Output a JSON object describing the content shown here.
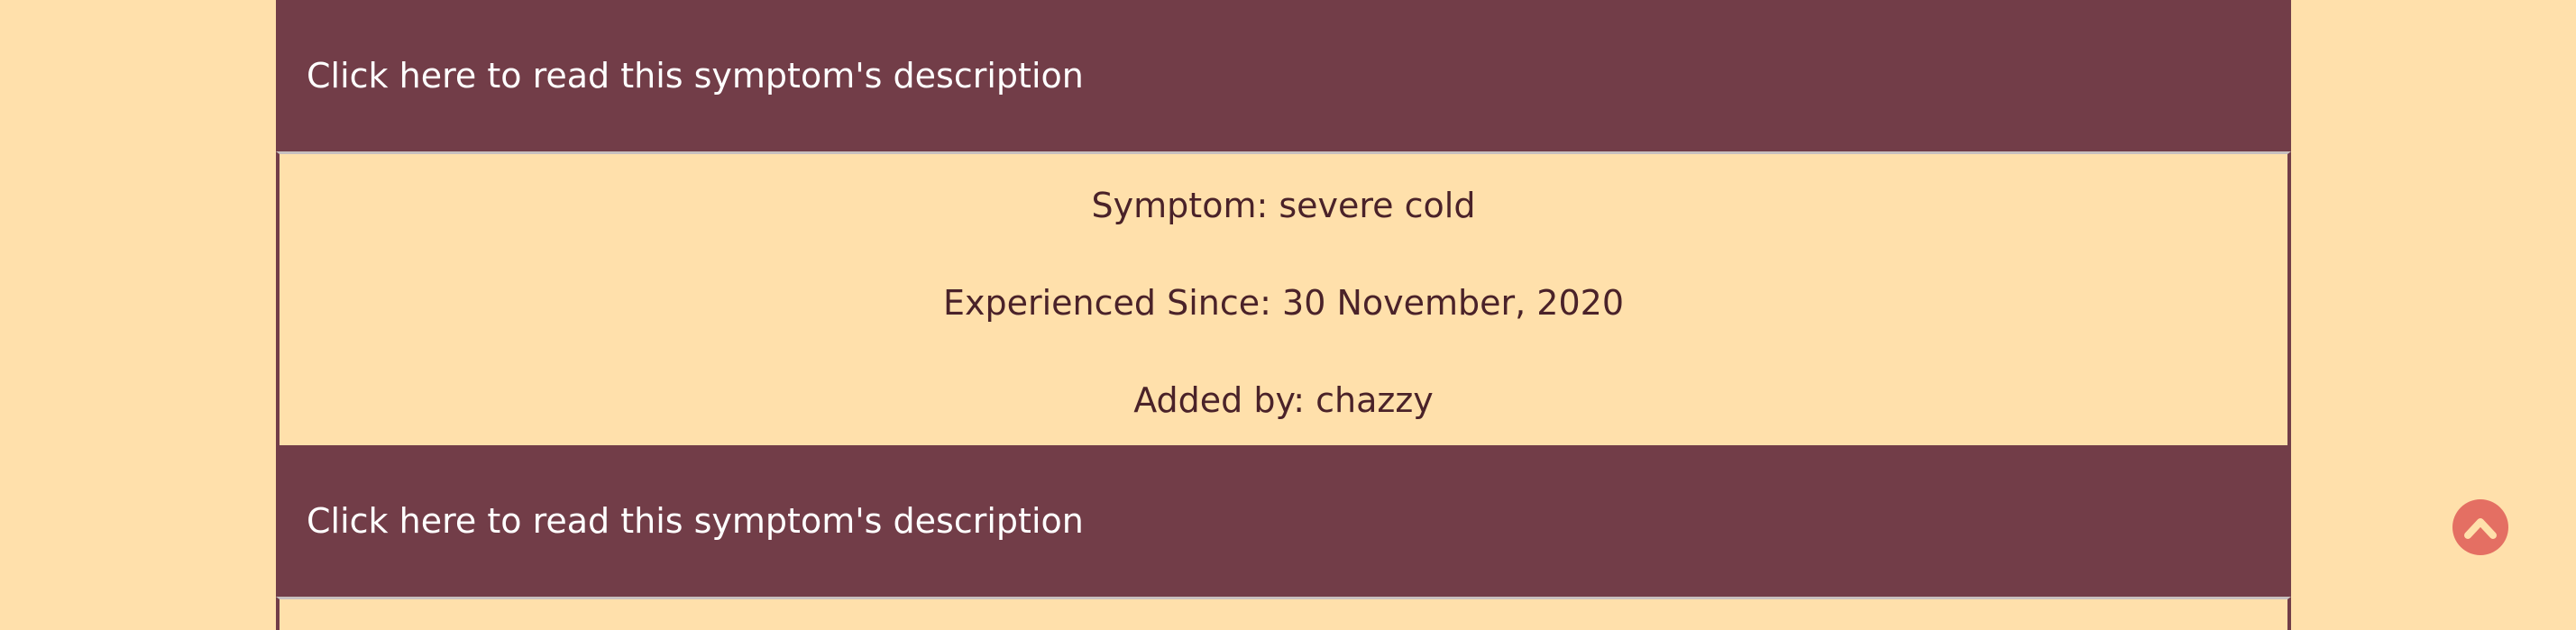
{
  "entries": [
    {
      "toggle_label": "Click here to read this symptom's description",
      "symptom_line": "Symptom: severe cold",
      "since_line": "Experienced Since: 30 November, 2020",
      "added_by_line": "Added by: chazzy"
    },
    {
      "toggle_label": "Click here to read this symptom's description"
    }
  ],
  "scroll_top_button": {
    "icon": "chevron-up-icon"
  },
  "colors": {
    "page_background": "#ffe0ab",
    "accent": "#723d48",
    "button": "#e46f63",
    "text": "#4a2229"
  }
}
